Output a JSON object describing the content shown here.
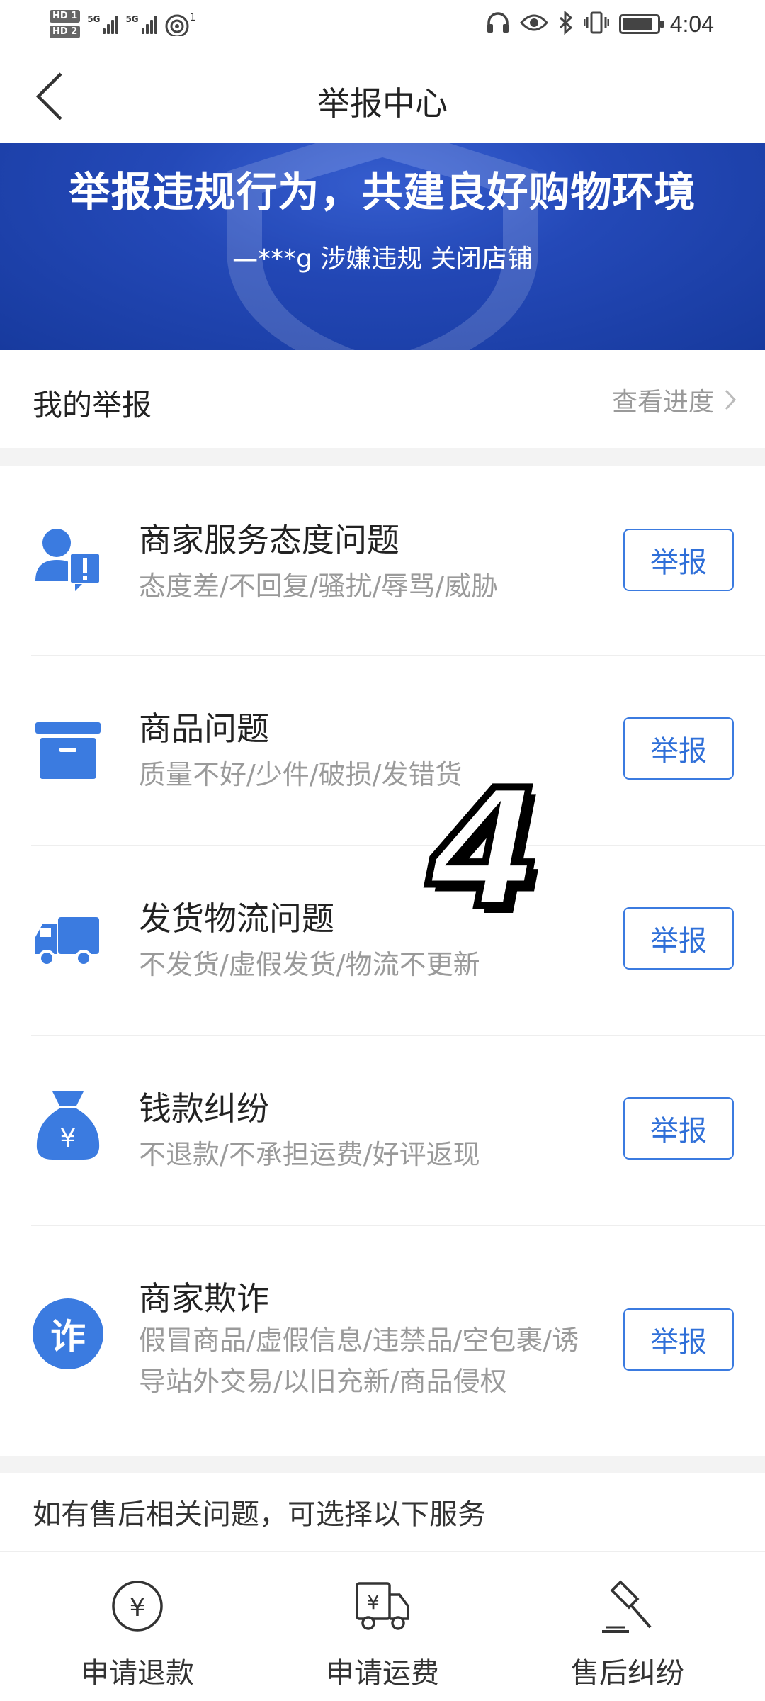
{
  "status_bar": {
    "hd1": "HD 1",
    "hd2": "HD 2",
    "sig1": "5G",
    "sig2": "5G",
    "wifi_badge": "1",
    "time": "4:04",
    "icons": [
      "headphones-icon",
      "eye-icon",
      "bluetooth-icon",
      "vibrate-icon",
      "battery-icon"
    ]
  },
  "nav": {
    "title": "举报中心",
    "back_icon": "chevron-left-icon"
  },
  "banner": {
    "title": "举报违规行为，共建良好购物环境",
    "subtitle": "—***g 涉嫌违规 关闭店铺"
  },
  "my_report": {
    "label": "我的举报",
    "link_label": "查看进度"
  },
  "report_items": [
    {
      "title": "商家服务态度问题",
      "desc": "态度差/不回复/骚扰/辱骂/威胁",
      "button": "举报",
      "icon": "user-alert-icon"
    },
    {
      "title": "商品问题",
      "desc": "质量不好/少件/破损/发错货",
      "button": "举报",
      "icon": "box-icon"
    },
    {
      "title": "发货物流问题",
      "desc": "不发货/虚假发货/物流不更新",
      "button": "举报",
      "icon": "truck-icon"
    },
    {
      "title": "钱款纠纷",
      "desc": "不退款/不承担运费/好评返现",
      "button": "举报",
      "icon": "money-bag-icon"
    },
    {
      "title": "商家欺诈",
      "desc": "假冒商品/虚假信息/违禁品/空包裹/诱导站外交易/以旧充新/商品侵权",
      "button": "举报",
      "icon": "fraud-icon",
      "icon_text": "诈"
    }
  ],
  "after_sale": {
    "hint": "如有售后相关问题，可选择以下服务",
    "services": [
      {
        "label": "申请退款",
        "icon": "yen-circle-icon"
      },
      {
        "label": "申请运费",
        "icon": "yen-truck-icon"
      },
      {
        "label": "售后纠纷",
        "icon": "gavel-icon"
      }
    ]
  },
  "overlay": {
    "sticker_text": "4"
  },
  "colors": {
    "accent": "#3b7be0",
    "banner": "#2449b8",
    "icon_blue": "#3b7be0"
  }
}
